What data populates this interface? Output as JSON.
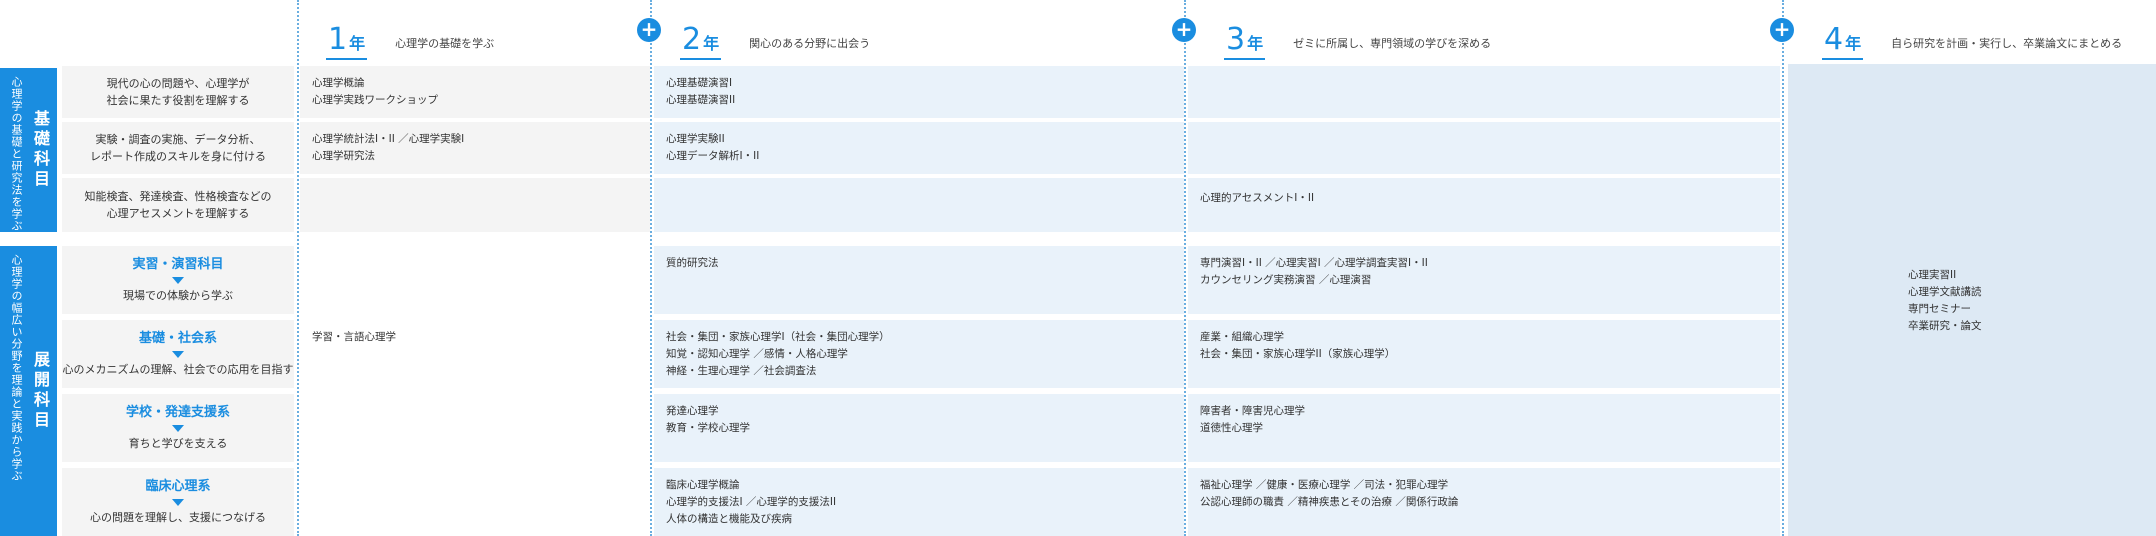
{
  "years": [
    {
      "num": "1",
      "unit": "年",
      "desc": "心理学の基礎を学ぶ"
    },
    {
      "num": "2",
      "unit": "年",
      "desc": "関心のある分野に出会う"
    },
    {
      "num": "3",
      "unit": "年",
      "desc": "ゼミに所属し、専門領域の学びを深める"
    },
    {
      "num": "4",
      "unit": "年",
      "desc": "自ら研究を計画・実行し、卒業論文にまとめる"
    }
  ],
  "plus_symbol": "+",
  "categories": {
    "basic": {
      "main": "基礎科目",
      "sub": "心理学の基礎と研究法を学ぶ"
    },
    "applied": {
      "main": "展開科目",
      "sub": "心理学の幅広い分野を理論と実践から学ぶ"
    }
  },
  "basic_rows": [
    {
      "label": "現代の心の問題や、心理学が\n社会に果たす役割を理解する",
      "y1": "心理学概論\n心理学実践ワークショップ",
      "y2": "心理基礎演習I\n心理基礎演習II",
      "y3": ""
    },
    {
      "label": "実験・調査の実施、データ分析、\nレポート作成のスキルを身に付ける",
      "y1": "心理学統計法I・II ／心理学実験I\n心理学研究法",
      "y2": "心理学実験II\n心理データ解析I・II",
      "y3": ""
    },
    {
      "label": "知能検査、発達検査、性格検査などの\n心理アセスメントを理解する",
      "y1": "",
      "y2": "",
      "y3": "心理的アセスメントI・II"
    }
  ],
  "applied_rows": [
    {
      "title": "実習・演習科目",
      "label": "現場での体験から学ぶ",
      "y1": "",
      "y2": "質的研究法",
      "y3": "専門演習I・II ／心理実習I ／心理学調査実習I・II\nカウンセリング実務演習 ／心理演習"
    },
    {
      "title": "基礎・社会系",
      "label": "心のメカニズムの理解、社会での応用を目指す",
      "y1": "学習・言語心理学",
      "y2": "社会・集団・家族心理学I（社会・集団心理学）\n知覚・認知心理学 ／感情・人格心理学\n神経・生理心理学 ／社会調査法",
      "y3": "産業・組織心理学\n社会・集団・家族心理学II（家族心理学）"
    },
    {
      "title": "学校・発達支援系",
      "label": "育ちと学びを支える",
      "y1": "",
      "y2": "発達心理学\n教育・学校心理学",
      "y3": "障害者・障害児心理学\n道徳性心理学"
    },
    {
      "title": "臨床心理系",
      "label": "心の問題を理解し、支援につなげる",
      "y1": "",
      "y2": "臨床心理学概論\n心理学的支援法I ／心理学的支援法II\n人体の構造と機能及び疾病",
      "y3": "福祉心理学 ／健康・医療心理学 ／司法・犯罪心理学\n公認心理師の職責 ／精神疾患とその治療 ／関係行政論"
    }
  ],
  "year4_courses": "心理実習II\n心理学文献講読\n専門セミナー\n卒業研究・論文"
}
